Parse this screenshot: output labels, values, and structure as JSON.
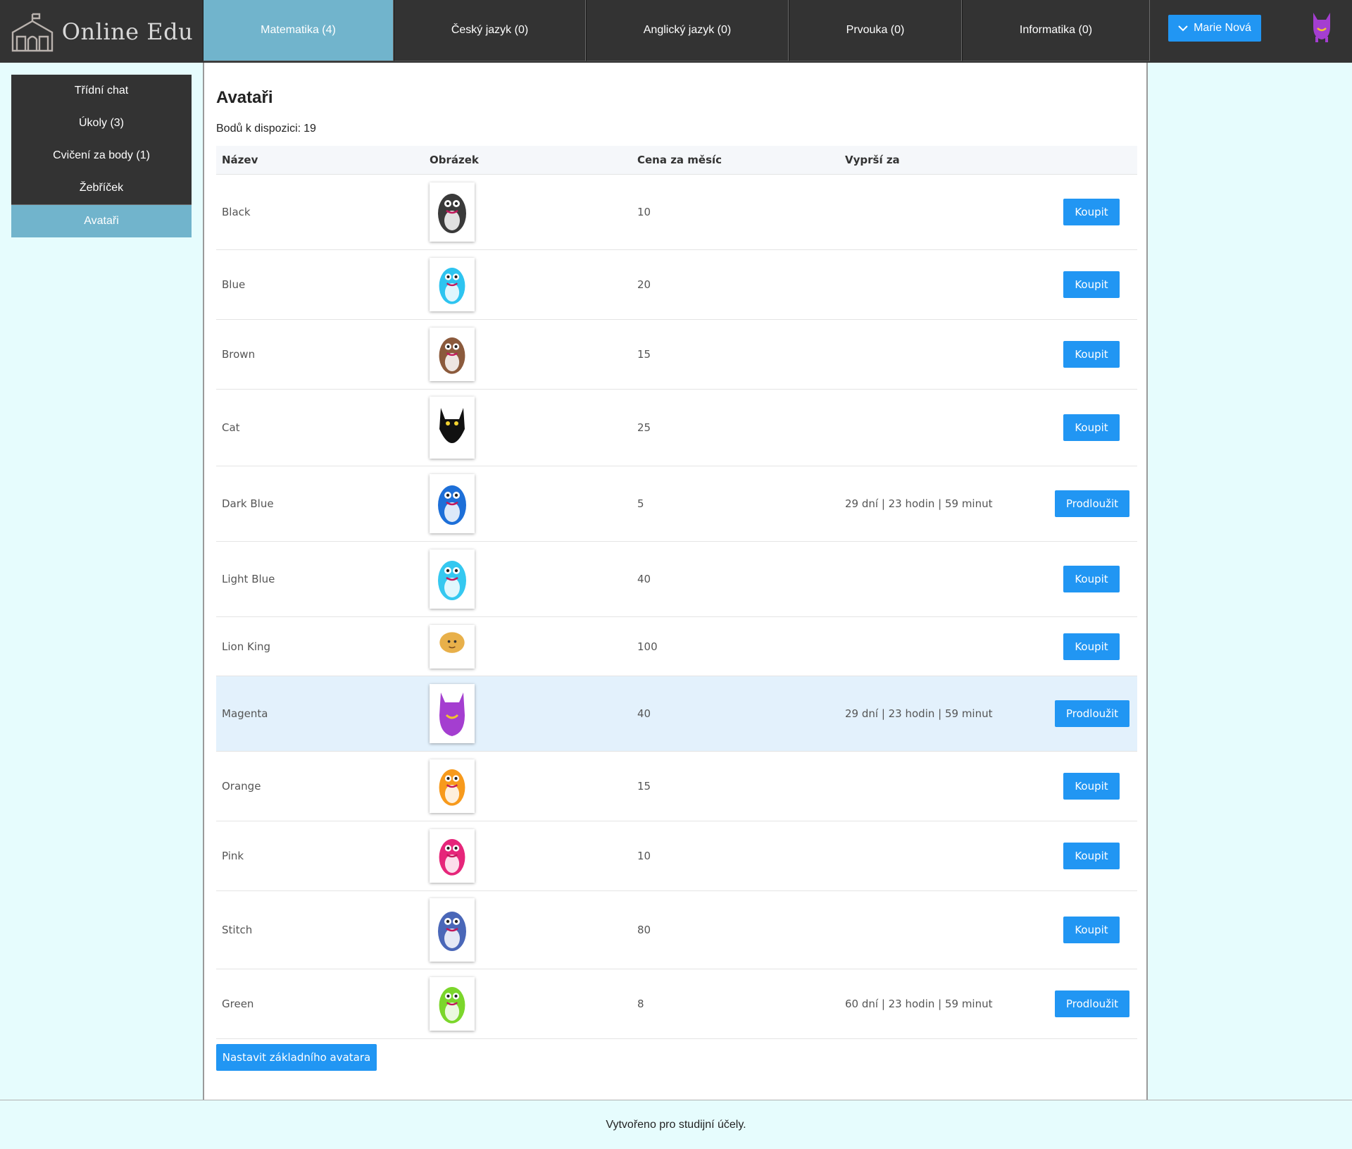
{
  "app": {
    "logo_text": "Online Edu"
  },
  "tabs": [
    {
      "label": "Matematika (4)",
      "active": true
    },
    {
      "label": "Český jazyk (0)",
      "active": false
    },
    {
      "label": "Anglický jazyk (0)",
      "active": false
    },
    {
      "label": "Prvouka (0)",
      "active": false
    },
    {
      "label": "Informatika (0)",
      "active": false
    }
  ],
  "user": {
    "name": "Marie Nová",
    "icon": "chevron-down-icon"
  },
  "sidebar": {
    "items": [
      {
        "label": "Třídní chat",
        "active": false
      },
      {
        "label": "Úkoly (3)",
        "active": false
      },
      {
        "label": "Cvičení za body (1)",
        "active": false
      },
      {
        "label": "Žebříček",
        "active": false
      },
      {
        "label": "Avataři",
        "active": true
      }
    ]
  },
  "main": {
    "title": "Avataři",
    "points_label": "Bodů k dispozici:",
    "points_value": "19",
    "columns": [
      "Název",
      "Obrázek",
      "Cena za měsíc",
      "Vyprší za"
    ],
    "rows": [
      {
        "name": "Black",
        "price": "10",
        "expires": "",
        "action": "Koupit",
        "color": "#3a3a3a"
      },
      {
        "name": "Blue",
        "price": "20",
        "expires": "",
        "action": "Koupit",
        "color": "#2ec4f0"
      },
      {
        "name": "Brown",
        "price": "15",
        "expires": "",
        "action": "Koupit",
        "color": "#8b5a3c"
      },
      {
        "name": "Cat",
        "price": "25",
        "expires": "",
        "action": "Koupit",
        "color": "#111111"
      },
      {
        "name": "Dark Blue",
        "price": "5",
        "expires": "29 dní | 23 hodin | 59 minut",
        "action": "Prodloužit",
        "color": "#1d6fd8"
      },
      {
        "name": "Light Blue",
        "price": "40",
        "expires": "",
        "action": "Koupit",
        "color": "#35c8f0"
      },
      {
        "name": "Lion King",
        "price": "100",
        "expires": "",
        "action": "Koupit",
        "color": "#e8b04a"
      },
      {
        "name": "Magenta",
        "price": "40",
        "expires": "29 dní | 23 hodin | 59 minut",
        "action": "Prodloužit",
        "color": "#a43ed0",
        "highlight": true
      },
      {
        "name": "Orange",
        "price": "15",
        "expires": "",
        "action": "Koupit",
        "color": "#f79a1c"
      },
      {
        "name": "Pink",
        "price": "10",
        "expires": "",
        "action": "Koupit",
        "color": "#e6267a"
      },
      {
        "name": "Stitch",
        "price": "80",
        "expires": "",
        "action": "Koupit",
        "color": "#4a67b8"
      },
      {
        "name": "Green",
        "price": "8",
        "expires": "60 dní | 23 hodin | 59 minut",
        "action": "Prodloužit",
        "color": "#7bd62b"
      }
    ],
    "default_button": "Nastavit základního avatara"
  },
  "footer": {
    "text": "Vytvořeno pro studijní účely."
  },
  "colors": {
    "header_bg": "#333333",
    "active_tab": "#71b4cc",
    "button": "#2196f3",
    "page_bg": "#e6fcfd",
    "row_highlight": "#e3f1fc"
  }
}
